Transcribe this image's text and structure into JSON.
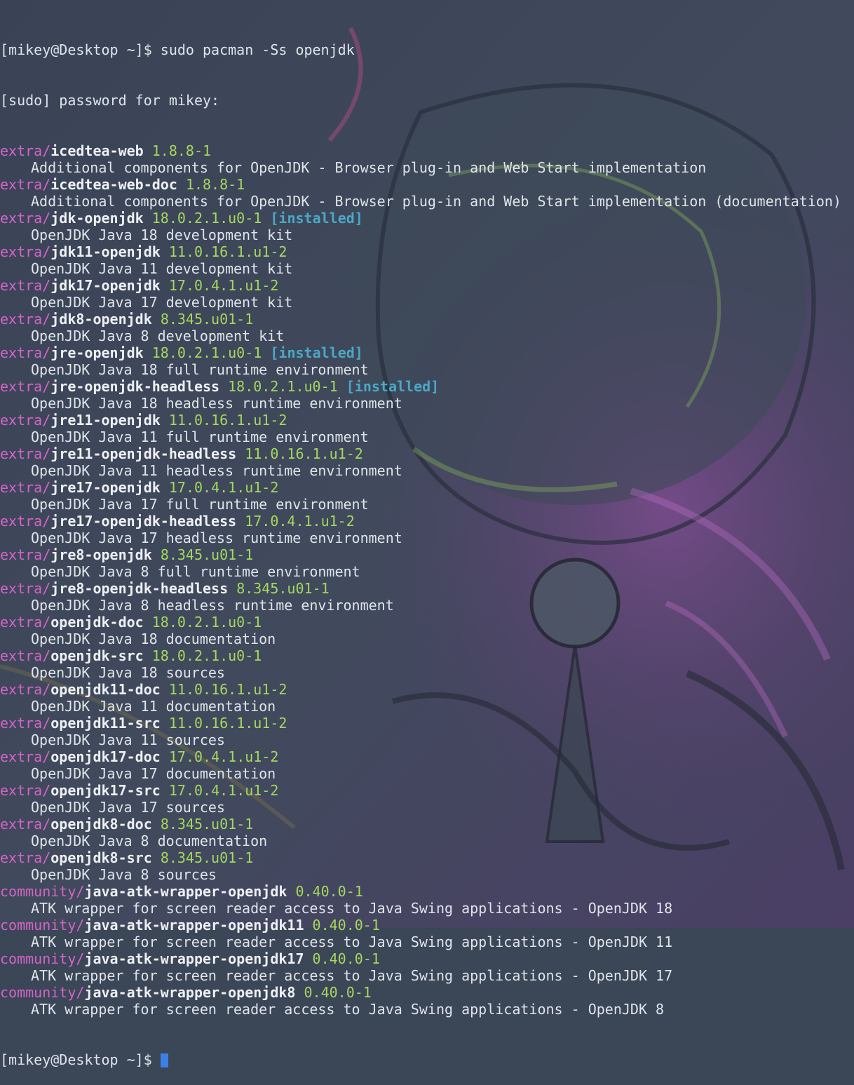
{
  "terminal": {
    "prompt": "[mikey@Desktop ~]$ ",
    "command": "sudo pacman -Ss openjdk",
    "sudo_prompt": "[sudo] password for mikey:",
    "packages": [
      {
        "repo": "extra",
        "name": "icedtea-web",
        "version": "1.8.8-1",
        "installed": "",
        "description": "Additional components for OpenJDK - Browser plug-in and Web Start implementation"
      },
      {
        "repo": "extra",
        "name": "icedtea-web-doc",
        "version": "1.8.8-1",
        "installed": "",
        "description": "Additional components for OpenJDK - Browser plug-in and Web Start implementation (documentation)"
      },
      {
        "repo": "extra",
        "name": "jdk-openjdk",
        "version": "18.0.2.1.u0-1",
        "installed": "[installed]",
        "description": "OpenJDK Java 18 development kit"
      },
      {
        "repo": "extra",
        "name": "jdk11-openjdk",
        "version": "11.0.16.1.u1-2",
        "installed": "",
        "description": "OpenJDK Java 11 development kit"
      },
      {
        "repo": "extra",
        "name": "jdk17-openjdk",
        "version": "17.0.4.1.u1-2",
        "installed": "",
        "description": "OpenJDK Java 17 development kit"
      },
      {
        "repo": "extra",
        "name": "jdk8-openjdk",
        "version": "8.345.u01-1",
        "installed": "",
        "description": "OpenJDK Java 8 development kit"
      },
      {
        "repo": "extra",
        "name": "jre-openjdk",
        "version": "18.0.2.1.u0-1",
        "installed": "[installed]",
        "description": "OpenJDK Java 18 full runtime environment"
      },
      {
        "repo": "extra",
        "name": "jre-openjdk-headless",
        "version": "18.0.2.1.u0-1",
        "installed": "[installed]",
        "description": "OpenJDK Java 18 headless runtime environment"
      },
      {
        "repo": "extra",
        "name": "jre11-openjdk",
        "version": "11.0.16.1.u1-2",
        "installed": "",
        "description": "OpenJDK Java 11 full runtime environment"
      },
      {
        "repo": "extra",
        "name": "jre11-openjdk-headless",
        "version": "11.0.16.1.u1-2",
        "installed": "",
        "description": "OpenJDK Java 11 headless runtime environment"
      },
      {
        "repo": "extra",
        "name": "jre17-openjdk",
        "version": "17.0.4.1.u1-2",
        "installed": "",
        "description": "OpenJDK Java 17 full runtime environment"
      },
      {
        "repo": "extra",
        "name": "jre17-openjdk-headless",
        "version": "17.0.4.1.u1-2",
        "installed": "",
        "description": "OpenJDK Java 17 headless runtime environment"
      },
      {
        "repo": "extra",
        "name": "jre8-openjdk",
        "version": "8.345.u01-1",
        "installed": "",
        "description": "OpenJDK Java 8 full runtime environment"
      },
      {
        "repo": "extra",
        "name": "jre8-openjdk-headless",
        "version": "8.345.u01-1",
        "installed": "",
        "description": "OpenJDK Java 8 headless runtime environment"
      },
      {
        "repo": "extra",
        "name": "openjdk-doc",
        "version": "18.0.2.1.u0-1",
        "installed": "",
        "description": "OpenJDK Java 18 documentation"
      },
      {
        "repo": "extra",
        "name": "openjdk-src",
        "version": "18.0.2.1.u0-1",
        "installed": "",
        "description": "OpenJDK Java 18 sources"
      },
      {
        "repo": "extra",
        "name": "openjdk11-doc",
        "version": "11.0.16.1.u1-2",
        "installed": "",
        "description": "OpenJDK Java 11 documentation"
      },
      {
        "repo": "extra",
        "name": "openjdk11-src",
        "version": "11.0.16.1.u1-2",
        "installed": "",
        "description": "OpenJDK Java 11 sources"
      },
      {
        "repo": "extra",
        "name": "openjdk17-doc",
        "version": "17.0.4.1.u1-2",
        "installed": "",
        "description": "OpenJDK Java 17 documentation"
      },
      {
        "repo": "extra",
        "name": "openjdk17-src",
        "version": "17.0.4.1.u1-2",
        "installed": "",
        "description": "OpenJDK Java 17 sources"
      },
      {
        "repo": "extra",
        "name": "openjdk8-doc",
        "version": "8.345.u01-1",
        "installed": "",
        "description": "OpenJDK Java 8 documentation"
      },
      {
        "repo": "extra",
        "name": "openjdk8-src",
        "version": "8.345.u01-1",
        "installed": "",
        "description": "OpenJDK Java 8 sources"
      },
      {
        "repo": "community",
        "name": "java-atk-wrapper-openjdk",
        "version": "0.40.0-1",
        "installed": "",
        "description": "ATK wrapper for screen reader access to Java Swing applications - OpenJDK 18"
      },
      {
        "repo": "community",
        "name": "java-atk-wrapper-openjdk11",
        "version": "0.40.0-1",
        "installed": "",
        "description": "ATK wrapper for screen reader access to Java Swing applications - OpenJDK 11"
      },
      {
        "repo": "community",
        "name": "java-atk-wrapper-openjdk17",
        "version": "0.40.0-1",
        "installed": "",
        "description": "ATK wrapper for screen reader access to Java Swing applications - OpenJDK 17"
      },
      {
        "repo": "community",
        "name": "java-atk-wrapper-openjdk8",
        "version": "0.40.0-1",
        "installed": "",
        "description": "ATK wrapper for screen reader access to Java Swing applications - OpenJDK 8"
      }
    ],
    "final_prompt": "[mikey@Desktop ~]$ "
  },
  "colors": {
    "background": "#3b4657",
    "repo": "#d563c7",
    "version": "#a6d75f",
    "installed": "#4aa8c6",
    "cursor": "#3d7fe6"
  }
}
